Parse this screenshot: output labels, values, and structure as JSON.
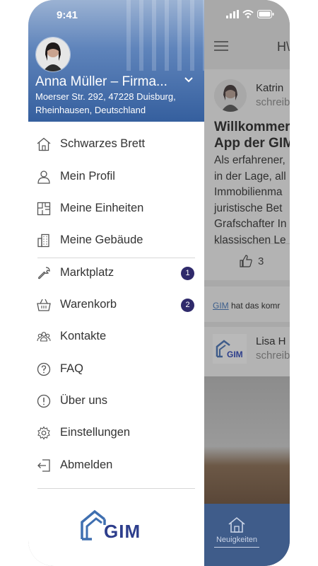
{
  "status_bar": {
    "time": "9:41"
  },
  "drawer": {
    "user": {
      "name": "Anna Müller – Firma...",
      "address_line1": "Moerser Str. 292, 47228 Duisburg,",
      "address_line2": "Rheinhausen, Deutschland"
    },
    "menu": [
      {
        "label": "Schwarzes Brett",
        "icon": "house-icon"
      },
      {
        "label": "Mein Profil",
        "icon": "person-icon"
      },
      {
        "label": "Meine Einheiten",
        "icon": "floorplan-icon"
      },
      {
        "label": "Meine Gebäude",
        "icon": "building-icon"
      },
      {
        "label": "Marktplatz",
        "icon": "wrench-icon",
        "badge": "1"
      },
      {
        "label": "Warenkorb",
        "icon": "basket-icon",
        "badge": "2"
      },
      {
        "label": "Kontakte",
        "icon": "contacts-icon"
      },
      {
        "label": "FAQ",
        "icon": "question-icon"
      },
      {
        "label": "Über uns",
        "icon": "info-icon"
      },
      {
        "label": "Einstellungen",
        "icon": "gear-icon"
      },
      {
        "label": "Abmelden",
        "icon": "logout-icon"
      }
    ],
    "logo_text": "GIM"
  },
  "background_app": {
    "header_title": "H\\",
    "post1": {
      "author": "Katrin",
      "subtitle": "schreib",
      "title_line1": "Willkommer",
      "title_line2": "App der GIM",
      "body": [
        "Als erfahrener,",
        "in der Lage, all",
        "Immobilienma",
        "juristische Bet",
        "Grafschafter In",
        "klassischen Le"
      ],
      "likes": "3"
    },
    "notice": {
      "link": "GIM",
      "text": " hat das komr"
    },
    "post2": {
      "author": "Lisa H",
      "subtitle": "schreib",
      "logo_text": "GIM"
    },
    "nav": {
      "label": "Neuigkeiten"
    }
  },
  "colors": {
    "accent": "#2f2a6b",
    "header_blue": "#355f9e",
    "logo_blue": "#2d3e8c"
  }
}
